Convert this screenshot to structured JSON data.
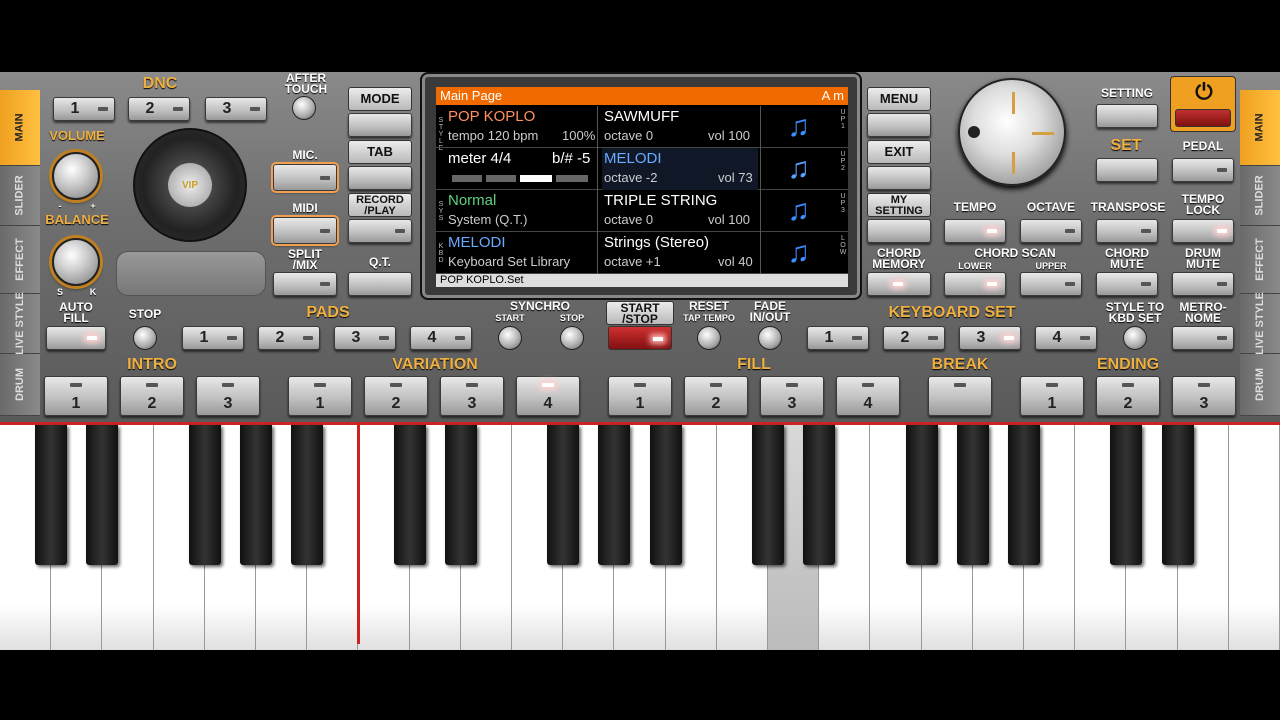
{
  "tabs_left": [
    {
      "label": "MAIN"
    },
    {
      "label": "SLIDER"
    },
    {
      "label": "EFFECT"
    },
    {
      "label": "LIVE STYLE"
    },
    {
      "label": "DRUM"
    }
  ],
  "tabs_right": [
    {
      "label": "MAIN"
    },
    {
      "label": "SLIDER"
    },
    {
      "label": "EFFECT"
    },
    {
      "label": "LIVE STYLE"
    },
    {
      "label": "DRUM"
    }
  ],
  "dnc": {
    "title": "DNC",
    "buttons": [
      "1",
      "2",
      "3"
    ]
  },
  "after_touch": "AFTER TOUCH",
  "volume": {
    "label": "VOLUME",
    "minus": "-",
    "plus": "+"
  },
  "balance": {
    "label": "BALANCE",
    "s": "S",
    "k": "K"
  },
  "vip": "VIP",
  "mic": "MIC.",
  "midi": "MIDI",
  "split_mix": "SPLIT /MIX",
  "mode": "MODE",
  "tab": "TAB",
  "record_play": "RECORD /PLAY",
  "qt": "Q.T.",
  "screen": {
    "header": "Main Page",
    "key": "A m",
    "side_left": [
      "S T Y L E",
      "S Y S",
      "K B D"
    ],
    "side_right": [
      "U P 1",
      "U P 2",
      "U P 3",
      "L O W"
    ],
    "row1": {
      "style": "POP KOPLO",
      "tempo": "tempo 120 bpm",
      "pct": "100%",
      "voice": "SAWMUFF",
      "octave": "octave  0",
      "vol": "vol 100"
    },
    "row2": {
      "meter": "meter 4/4",
      "bsharp": "b/# -5",
      "voice": "MELODI",
      "octave": "octave -2",
      "vol": "vol 73"
    },
    "row3": {
      "sys1": "Normal",
      "sys2": "System (Q.T.)",
      "voice": "TRIPLE STRING",
      "octave": "octave  0",
      "vol": "vol 100"
    },
    "row4": {
      "kbd1": "MELODI",
      "kbd2": "Keyboard Set Library",
      "voice": "Strings (Stereo)",
      "octave": "octave +1",
      "vol": "vol 40"
    },
    "footer": "POP KOPLO.Set",
    "note_icon": "♫"
  },
  "menu": "MENU",
  "exit": "EXIT",
  "my_setting": "MY SETTING",
  "chord_memory": "CHORD MEMORY",
  "setting": "SETTING",
  "set": "SET",
  "pedal": "PEDAL",
  "power_icon": "⏻",
  "tempo": "TEMPO",
  "octave": "OCTAVE",
  "transpose": "TRANSPOSE",
  "tempo_lock": "TEMPO LOCK",
  "chord_scan": "CHORD SCAN",
  "lower": "LOWER",
  "upper": "UPPER",
  "chord_mute": "CHORD MUTE",
  "drum_mute": "DRUM MUTE",
  "auto_fill": "AUTO FILL",
  "stop": "STOP",
  "pads": {
    "title": "PADS",
    "buttons": [
      "1",
      "2",
      "3",
      "4"
    ]
  },
  "synchro": {
    "title": "SYNCHRO",
    "start": "START",
    "stop": "STOP"
  },
  "start_stop": "START /STOP",
  "reset": "RESET",
  "tap_tempo": "TAP TEMPO",
  "fade": "FADE IN/OUT",
  "keyboard_set": {
    "title": "KEYBOARD SET",
    "buttons": [
      "1",
      "2",
      "3",
      "4"
    ]
  },
  "style_to_kbd": "STYLE TO KBD SET",
  "metronome": "METRO- NOME",
  "intro": {
    "title": "INTRO",
    "buttons": [
      "1",
      "2",
      "3"
    ]
  },
  "variation": {
    "title": "VARIATION",
    "buttons": [
      "1",
      "2",
      "3",
      "4"
    ]
  },
  "fill": {
    "title": "FILL",
    "buttons": [
      "1",
      "2",
      "3",
      "4"
    ]
  },
  "break": {
    "title": "BREAK"
  },
  "ending": {
    "title": "ENDING",
    "buttons": [
      "1",
      "2",
      "3"
    ]
  }
}
